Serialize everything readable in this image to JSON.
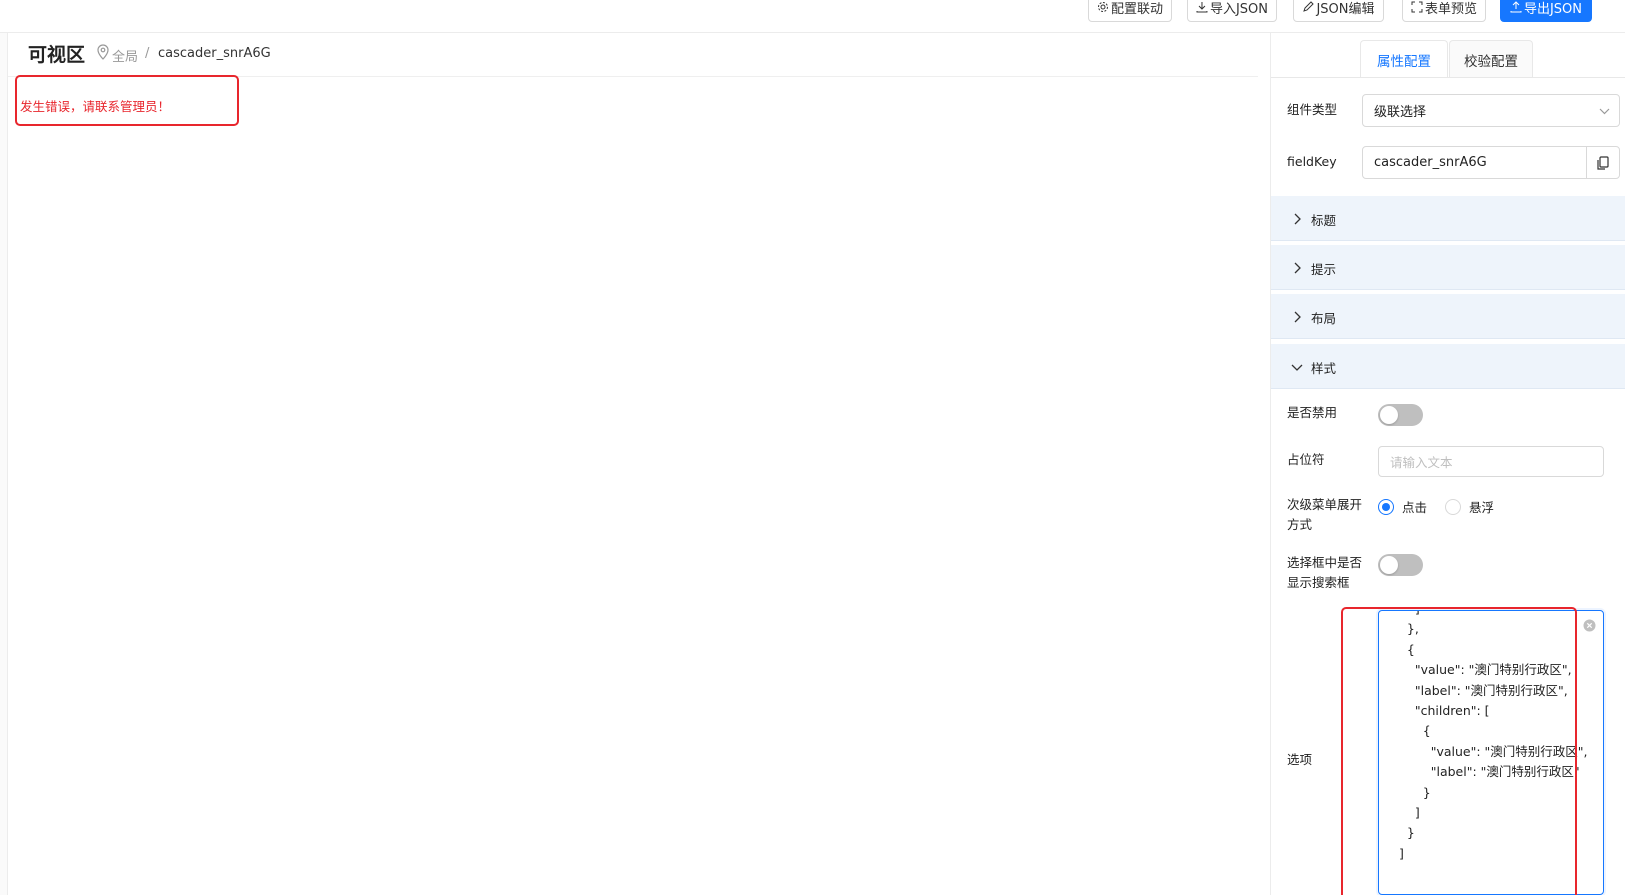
{
  "toolbar": {
    "linkage_label": "配置联动",
    "import_label": "导入JSON",
    "edit_label": "JSON编辑",
    "preview_label": "表单预览",
    "export_label": "导出JSON"
  },
  "canvas": {
    "title": "可视区",
    "breadcrumb_root": "全局",
    "breadcrumb_sep": "/",
    "breadcrumb_current": "cascader_snrA6G",
    "error_message": "发生错误，请联系管理员！"
  },
  "panel": {
    "tabs": [
      {
        "label": "属性配置",
        "active": true
      },
      {
        "label": "校验配置",
        "active": false
      }
    ],
    "component_type_label": "组件类型",
    "component_type_value": "级联选择",
    "field_key_label": "fieldKey",
    "field_key_value": "cascader_snrA6G",
    "sections": [
      {
        "label": "标题",
        "expanded": false
      },
      {
        "label": "提示",
        "expanded": false
      },
      {
        "label": "布局",
        "expanded": false
      },
      {
        "label": "样式",
        "expanded": true
      }
    ],
    "disabled_label": "是否禁用",
    "disabled_on": false,
    "placeholder_label": "占位符",
    "placeholder_hint": "请输入文本",
    "expand_trigger_label": "次级菜单展开方式",
    "expand_trigger_options": [
      {
        "label": "点击",
        "checked": true
      },
      {
        "label": "悬浮",
        "checked": false
      }
    ],
    "show_search_label": "选择框中是否显示搜索框",
    "show_search_on": false,
    "options_label": "选项",
    "options_json": "      ]\n    },\n    {\n      \"value\": \"澳门特别行政区\",\n      \"label\": \"澳门特别行政区\",\n      \"children\": [\n        {\n          \"value\": \"澳门特别行政区\",\n          \"label\": \"澳门特别行政区\"\n        }\n      ]\n    }\n  ]"
  },
  "colors": {
    "primary": "#1677ff",
    "error": "#e8262d",
    "section_bg": "#eef4fb"
  }
}
